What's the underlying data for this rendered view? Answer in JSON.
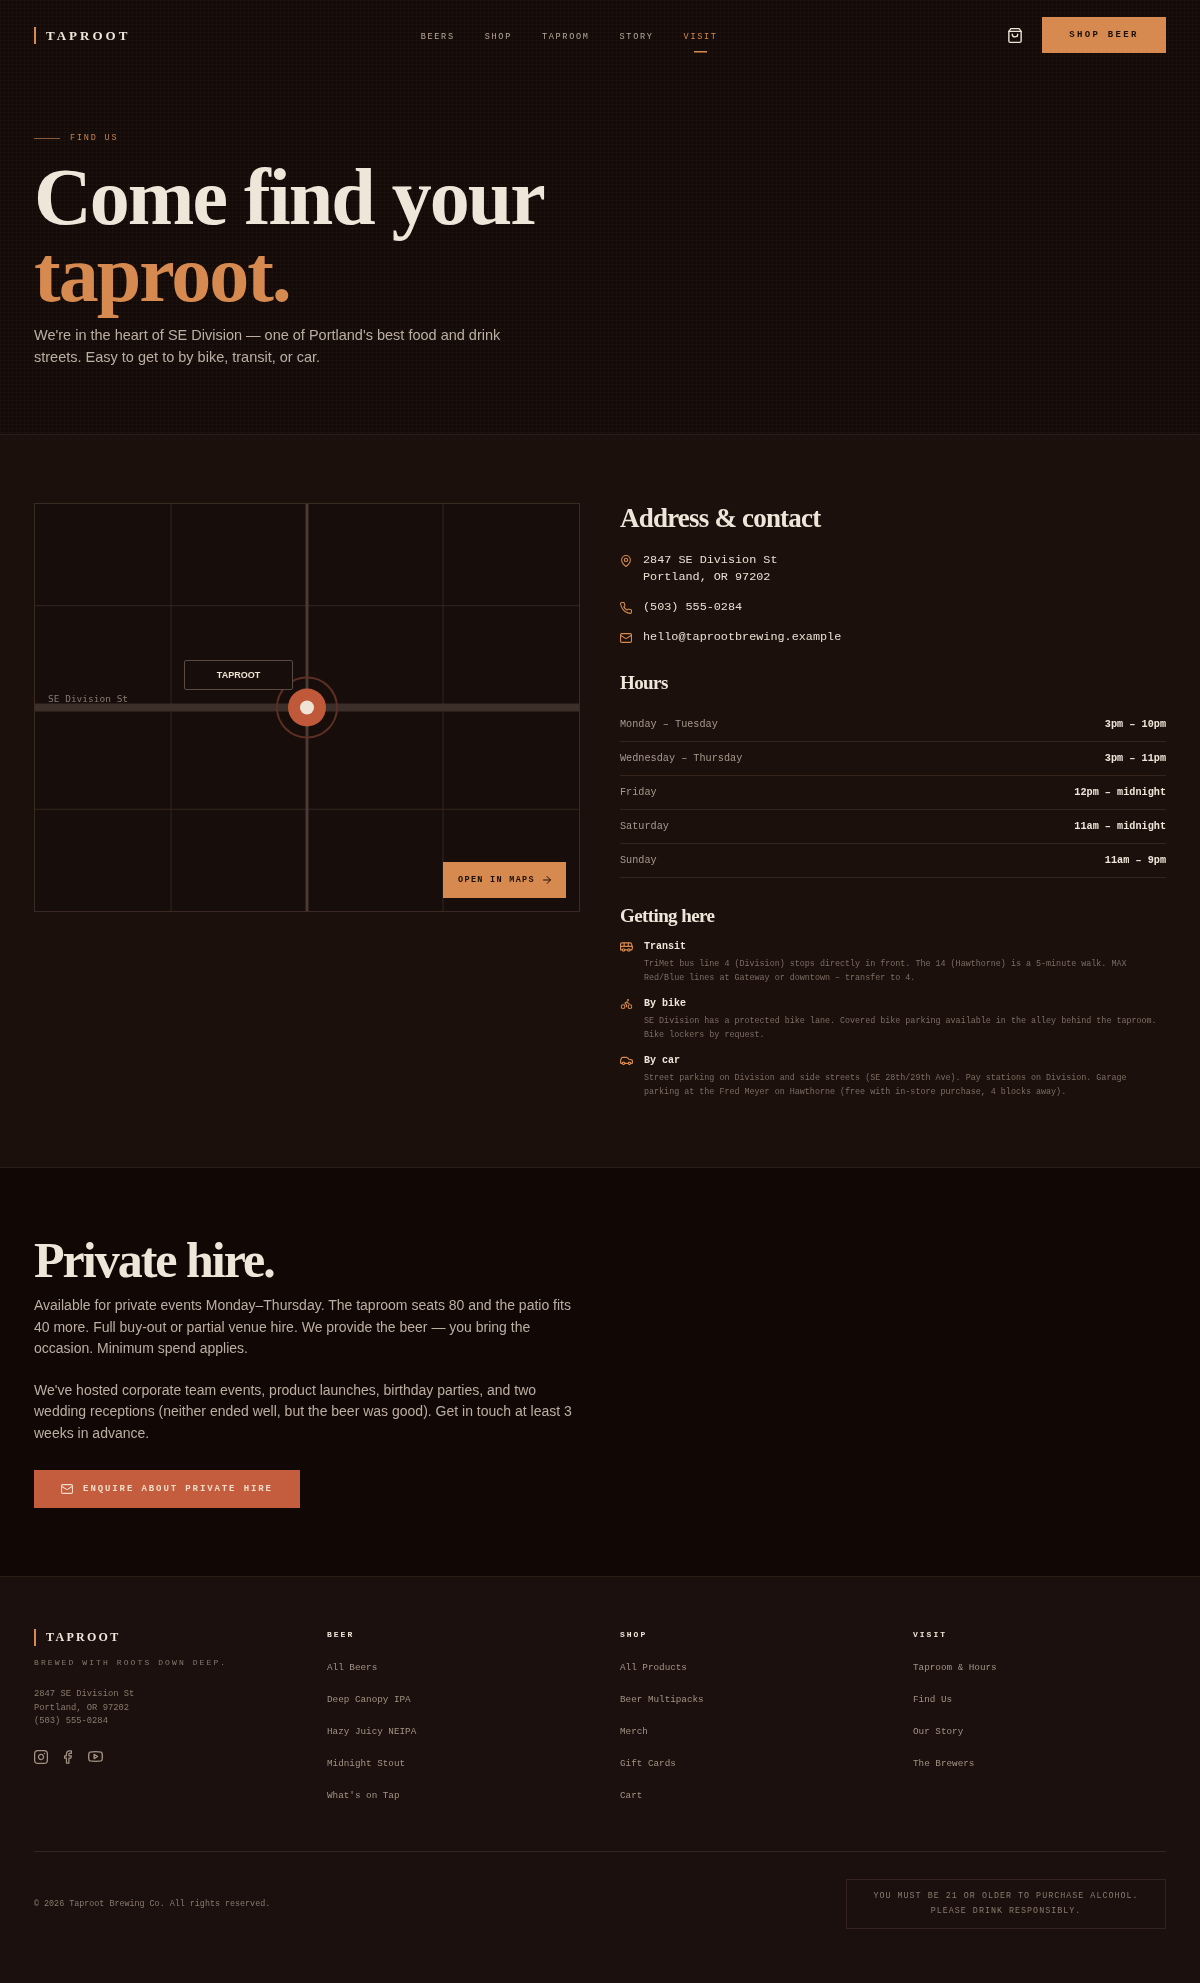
{
  "header": {
    "logo": "TAPROOT",
    "nav": [
      {
        "label": "BEERS",
        "selected": false
      },
      {
        "label": "SHOP",
        "selected": false
      },
      {
        "label": "TAPROOM",
        "selected": false
      },
      {
        "label": "STORY",
        "selected": false
      },
      {
        "label": "VISIT",
        "selected": true
      }
    ],
    "cta": "SHOP BEER"
  },
  "hero": {
    "eyebrow": "FIND US",
    "title": "Come find your",
    "title_accent": "taproot.",
    "intro": "We're in the heart of SE Division — one of Portland's best food and drink streets. Easy to get to by bike, transit, or car."
  },
  "map": {
    "street_label": "SE Division St",
    "pin_label": "TAPROOT",
    "button": "OPEN IN MAPS"
  },
  "contact": {
    "title": "Address & contact",
    "items": [
      {
        "kind": "address",
        "lines": [
          "2847 SE Division St",
          "Portland, OR 97202"
        ]
      },
      {
        "kind": "phone",
        "lines": [
          "(503) 555-0284"
        ]
      },
      {
        "kind": "email",
        "lines": [
          "hello@taprootbrewing.example"
        ]
      }
    ]
  },
  "hours": {
    "title": "Hours",
    "rows": [
      {
        "days": "Monday – Tuesday",
        "time": "3pm – 10pm"
      },
      {
        "days": "Wednesday – Thursday",
        "time": "3pm – 11pm"
      },
      {
        "days": "Friday",
        "time": "12pm – midnight"
      },
      {
        "days": "Saturday",
        "time": "11am – midnight"
      },
      {
        "days": "Sunday",
        "time": "11am – 9pm"
      }
    ]
  },
  "getting_here": {
    "title": "Getting here",
    "modes": [
      {
        "kind": "transit",
        "title": "Transit",
        "text": "TriMet bus line 4 (Division) stops directly in front. The 14 (Hawthorne) is a 5-minute walk. MAX Red/Blue lines at Gateway or downtown – transfer to 4."
      },
      {
        "kind": "bike",
        "title": "By bike",
        "text": "SE Division has a protected bike lane. Covered bike parking available in the alley behind the taproom. Bike lockers by request."
      },
      {
        "kind": "car",
        "title": "By car",
        "text": "Street parking on Division and side streets (SE 28th/29th Ave). Pay stations on Division. Garage parking at the Fred Meyer on Hawthorne (free with in-store purchase, 4 blocks away)."
      }
    ]
  },
  "private_hire": {
    "title": "Private hire.",
    "paragraphs": [
      "Available for private events Monday–Thursday. The taproom seats 80 and the patio fits 40 more. Full buy-out or partial venue hire. We provide the beer — you bring the occasion. Minimum spend applies.",
      "We've hosted corporate team events, product launches, birthday parties, and two wedding receptions (neither ended well, but the beer was good). Get in touch at least 3 weeks in advance."
    ],
    "button": "ENQUIRE ABOUT PRIVATE HIRE"
  },
  "footer": {
    "logo": "TAPROOT",
    "tagline": "BREWED WITH ROOTS DOWN DEEP.",
    "address_lines": [
      "2847 SE Division St",
      "Portland, OR 97202",
      "(503) 555-0284"
    ],
    "social": [
      {
        "kind": "instagram"
      },
      {
        "kind": "facebook"
      },
      {
        "kind": "youtube"
      }
    ],
    "columns": [
      {
        "title": "BEER",
        "links": [
          "All Beers",
          "Deep Canopy IPA",
          "Hazy Juicy NEIPA",
          "Midnight Stout",
          "What's on Tap"
        ]
      },
      {
        "title": "SHOP",
        "links": [
          "All Products",
          "Beer Multipacks",
          "Merch",
          "Gift Cards",
          "Cart"
        ]
      },
      {
        "title": "VISIT",
        "links": [
          "Taproom & Hours",
          "Find Us",
          "Our Story",
          "The Brewers"
        ]
      }
    ],
    "copyright": "© 2026 Taproot Brewing Co. All rights reserved.",
    "age_notice": [
      "YOU MUST BE 21 OR OLDER TO PURCHASE ALCOHOL.",
      "PLEASE DRINK RESPONSIBLY."
    ]
  }
}
